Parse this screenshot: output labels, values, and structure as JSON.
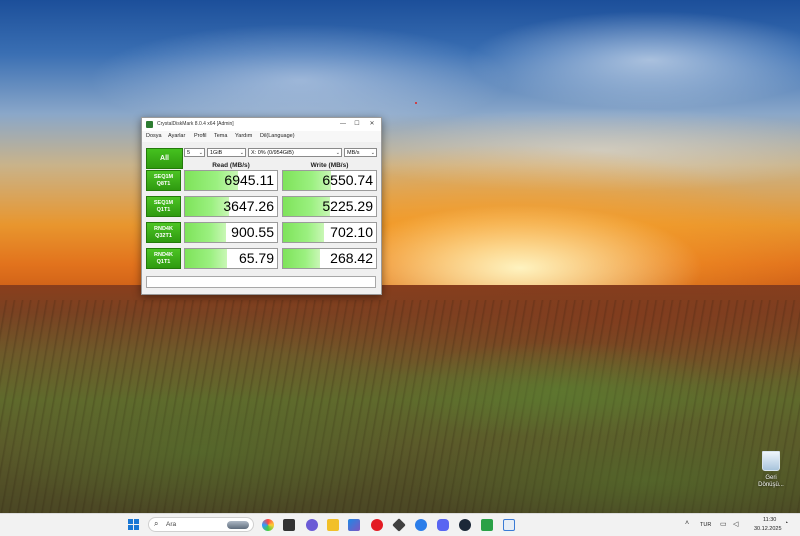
{
  "desktop": {
    "recycle_bin_label": "Geri Dönüşü..."
  },
  "window": {
    "title": "CrystalDiskMark 8.0.4 x64 [Admin]",
    "controls": {
      "minimize": "—",
      "maximize": "☐",
      "close": "✕"
    },
    "menu": [
      "Dosya",
      "Ayarlar",
      "Profil",
      "Tema",
      "Yardım",
      "Dil(Language)"
    ],
    "all_button": "All",
    "test_count": "5",
    "test_size": "1GiB",
    "drive": "X: 0% (0/954GiB)",
    "unit": "MB/s",
    "read_header": "Read (MB/s)",
    "write_header": "Write (MB/s)",
    "tests": [
      {
        "line1": "SEQ1M",
        "line2": "Q8T1",
        "read": "6945.11",
        "write": "6550.74",
        "read_fill": 0.58,
        "write_fill": 0.52
      },
      {
        "line1": "SEQ1M",
        "line2": "Q1T1",
        "read": "3647.26",
        "write": "5225.29",
        "read_fill": 0.48,
        "write_fill": 0.5
      },
      {
        "line1": "RND4K",
        "line2": "Q32T1",
        "read": "900.55",
        "write": "702.10",
        "read_fill": 0.45,
        "write_fill": 0.44
      },
      {
        "line1": "RND4K",
        "line2": "Q1T1",
        "read": "65.79",
        "write": "268.42",
        "read_fill": 0.46,
        "write_fill": 0.4
      }
    ]
  },
  "taskbar": {
    "search_placeholder": "Ara",
    "language": "TUR",
    "time": "11:30",
    "date": "30.12.2025"
  },
  "colors": {
    "accent_green": "#2f9a10",
    "bar_green": "#8cec6a",
    "start_blue": "#1a78d4"
  }
}
